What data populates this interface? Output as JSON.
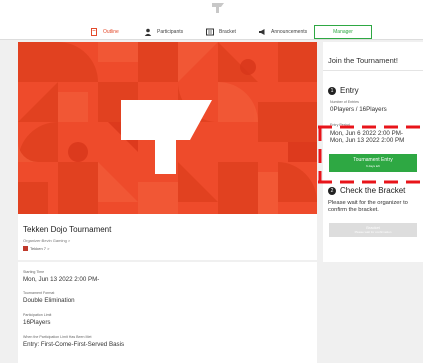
{
  "nav": {
    "items": [
      {
        "label": "Outline",
        "icon": "document-icon"
      },
      {
        "label": "Participants",
        "icon": "person-icon"
      },
      {
        "label": "Bracket",
        "icon": "bracket-icon"
      },
      {
        "label": "Announcements",
        "icon": "megaphone-icon"
      },
      {
        "label": "Manager"
      }
    ]
  },
  "tournament": {
    "title": "Tekken Dojo Tournament",
    "organizer": "Organizer:Bevin Gaming >",
    "game": "Tekken 7 >"
  },
  "details": {
    "start_label": "Starting Time",
    "start_value": "Mon, Jun 13 2022 2:00 PM-",
    "format_label": "Tournament Format",
    "format_value": "Double Elimination",
    "limit_label": "Participation Limit",
    "limit_value": "16Players",
    "when_label": "When the Participation Limit Has Been Met",
    "when_value": "Entry: First-Come-First-Served Basis"
  },
  "sidebar": {
    "join_title": "Join the Tournament!",
    "step1_num": "1",
    "step1_title": "Entry",
    "entries_label": "Number of Entries",
    "entries_value": "0Players / 16Players",
    "period_label": "Entry Period",
    "period_line1": "Mon, Jun 6 2022 2:00 PM-",
    "period_line2": "Mon, Jun 13 2022 2:00 PM",
    "entry_button": "Tournament Entry",
    "entry_button_sub": "6 days left",
    "step2_num": "2",
    "step2_title": "Check the Bracket",
    "bracket_note": "Please wait for the organizer to confirm the bracket.",
    "bracket_button": "Bracket",
    "bracket_button_sub": "Please wait for confirmation"
  },
  "colors": {
    "accent": "#ee4b2b",
    "green": "#2ea843",
    "dash": "#e8141a"
  }
}
